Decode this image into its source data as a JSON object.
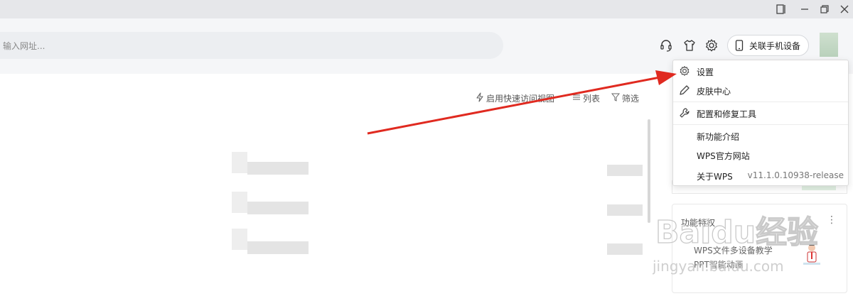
{
  "window": {
    "controls": [
      "sidebar-toggle-icon",
      "minimize-icon",
      "restore-icon",
      "close-icon"
    ]
  },
  "search": {
    "placeholder": "输入网址..."
  },
  "toolbar": {
    "icons": [
      "headset-icon",
      "skin-shirt-icon",
      "settings-gear-icon"
    ],
    "phone_button_label": "关联手机设备"
  },
  "view_tools": {
    "quick_access_label": "启用快速访问视图",
    "list_label": "列表",
    "filter_label": "筛选"
  },
  "menu": {
    "items": [
      {
        "label": "设置",
        "icon": "gear-icon"
      },
      {
        "label": "皮肤中心",
        "icon": "brush-icon"
      },
      {
        "label": "配置和修复工具",
        "icon": "wrench-icon"
      },
      {
        "label": "新功能介绍",
        "icon": ""
      },
      {
        "label": "WPS官方网站",
        "icon": ""
      },
      {
        "label": "关于WPS",
        "icon": "",
        "version": "v11.1.0.10938-release"
      }
    ]
  },
  "feature_panel": {
    "title": "功能特权",
    "items": [
      "WPS文件多设备教学",
      "PPT智能动画"
    ]
  },
  "watermark": {
    "text": "Baidu经验",
    "url": "jingyan.baidu.com"
  },
  "colors": {
    "arrow": "#e02a20",
    "titlebar": "#e6e7ea",
    "toolbar": "#f5f6f8"
  }
}
